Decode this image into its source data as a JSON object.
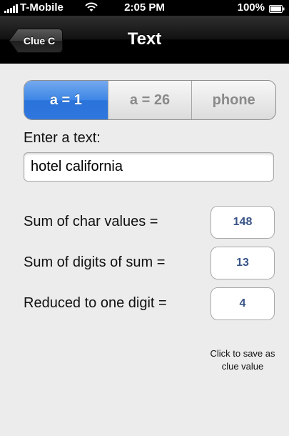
{
  "status_bar": {
    "carrier": "T-Mobile",
    "time": "2:05 PM",
    "battery": "100%",
    "icons": [
      "signal-icon",
      "wifi-icon",
      "battery-icon"
    ]
  },
  "nav": {
    "back_label": "Clue C",
    "title": "Text"
  },
  "segments": {
    "options": [
      "a = 1",
      "a = 26",
      "phone"
    ],
    "selected_index": 0,
    "accent_color": "#3d86e6"
  },
  "input": {
    "label": "Enter a text:",
    "value": "hotel california"
  },
  "results": [
    {
      "label": "Sum of char values =",
      "value": "148"
    },
    {
      "label": "Sum of digits of sum =",
      "value": "13"
    },
    {
      "label": "Reduced to one digit =",
      "value": "4"
    }
  ],
  "hint": "Click to save as clue value"
}
